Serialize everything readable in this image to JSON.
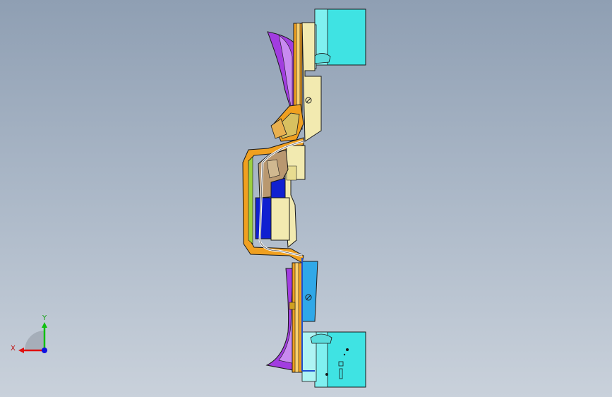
{
  "triad": {
    "x_label": "X",
    "y_label": "Y",
    "colors": {
      "x": "#e01010",
      "y": "#10c010",
      "z": "#1010e0"
    }
  },
  "model": {
    "colors": {
      "cyan": "#33e6e6",
      "purple": "#a23de0",
      "orange": "#f0a020",
      "cream": "#f2eab0",
      "tan": "#b99870",
      "blue": "#1020d0",
      "sky": "#30a8e8",
      "outline": "#202020"
    }
  }
}
